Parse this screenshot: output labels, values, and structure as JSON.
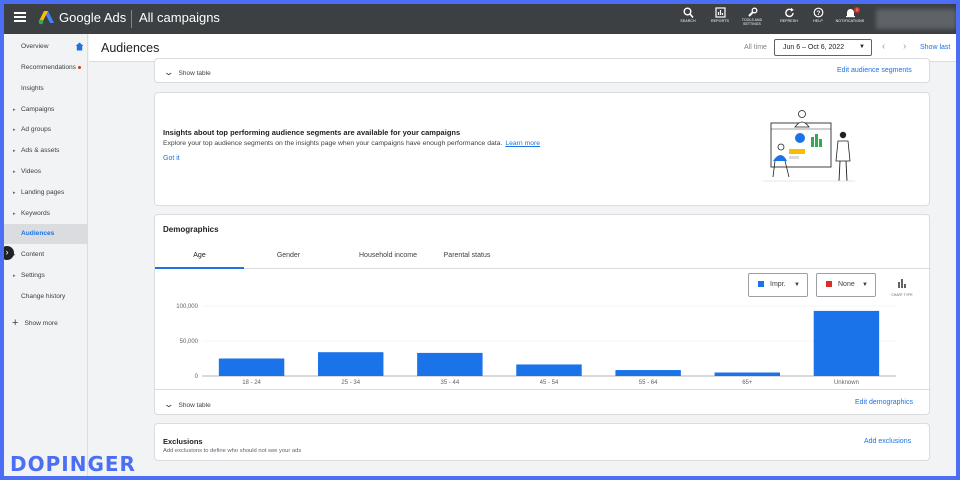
{
  "topbar": {
    "brand": "Google Ads",
    "context": "All campaigns",
    "tools": [
      {
        "label": "SEARCH",
        "icon": "search-icon"
      },
      {
        "label": "REPORTS",
        "icon": "reports-icon"
      },
      {
        "label": "TOOLS AND SETTINGS",
        "icon": "wrench-icon"
      },
      {
        "label": "REFRESH",
        "icon": "refresh-icon"
      },
      {
        "label": "HELP",
        "icon": "help-icon"
      },
      {
        "label": "NOTIFICATIONS",
        "icon": "bell-icon"
      }
    ],
    "notification_count": "1"
  },
  "sidebar": {
    "items": [
      {
        "label": "Overview"
      },
      {
        "label": "Recommendations"
      },
      {
        "label": "Insights"
      },
      {
        "label": "Campaigns"
      },
      {
        "label": "Ad groups"
      },
      {
        "label": "Ads & assets"
      },
      {
        "label": "Videos"
      },
      {
        "label": "Landing pages"
      },
      {
        "label": "Keywords"
      },
      {
        "label": "Audiences"
      },
      {
        "label": "Content"
      },
      {
        "label": "Settings"
      },
      {
        "label": "Change history"
      }
    ],
    "active": "Audiences",
    "show_more": "Show more"
  },
  "header": {
    "title": "Audiences",
    "all_time": "All time",
    "date_range": "Jun 6 – Oct 6, 2022",
    "show_last": "Show last"
  },
  "segments_card": {
    "show_table": "Show table",
    "edit_link": "Edit audience segments"
  },
  "insights_card": {
    "title": "Insights about top performing audience segments are available for your campaigns",
    "body": "Explore your top audience segments on the insights page when your campaigns have enough performance data.",
    "learn_more": "Learn more",
    "got_it": "Got it"
  },
  "demographics": {
    "title": "Demographics",
    "tabs": [
      "Age",
      "Gender",
      "Household income",
      "Parental status"
    ],
    "active_tab": "Age",
    "metric1": "Impr.",
    "metric1_color": "#1a73e8",
    "metric2": "None",
    "metric2_color": "#d93025",
    "chart_type_label": "CHART TYPE",
    "show_table": "Show table",
    "edit_link": "Edit demographics"
  },
  "chart_data": {
    "type": "bar",
    "categories": [
      "18 - 24",
      "25 - 34",
      "35 - 44",
      "45 - 54",
      "55 - 64",
      "65+",
      "Unknown"
    ],
    "values": [
      25000,
      34000,
      33000,
      16500,
      8500,
      5000,
      93000
    ],
    "ylim": [
      0,
      100000
    ],
    "yticks": [
      "100,000",
      "50,000",
      "0"
    ],
    "bar_color": "#1a73e8",
    "grid": true
  },
  "exclusions": {
    "title": "Exclusions",
    "subtitle": "Add exclusions to define who should not see your ads",
    "add_link": "Add exclusions"
  },
  "watermark": "DOPINGER"
}
